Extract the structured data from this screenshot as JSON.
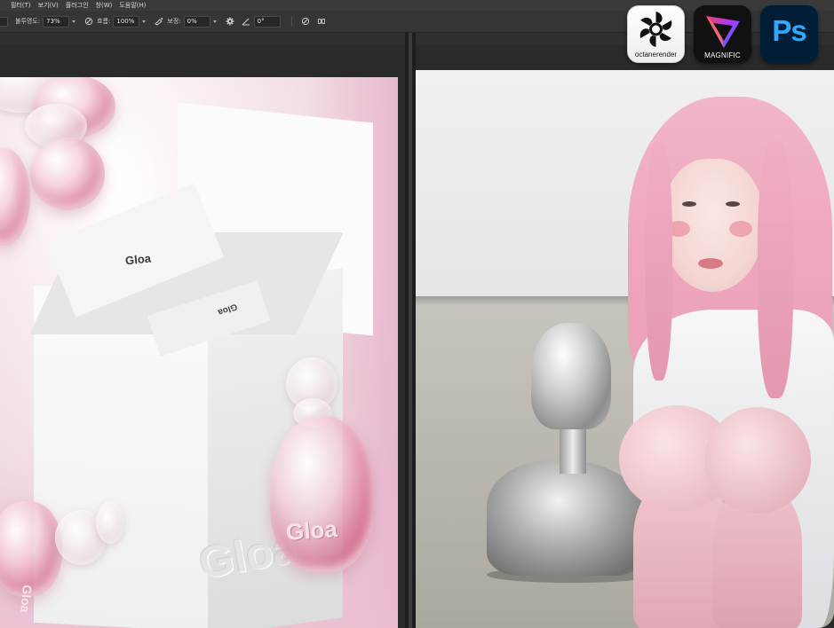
{
  "menubar": {
    "items": [
      "필터(T)",
      "보기(V)",
      "플러그인",
      "창(W)",
      "도움말(H)"
    ]
  },
  "options": {
    "opacity_label": "불투명도:",
    "opacity_value": "73%",
    "flow_label": "흐름:",
    "flow_value": "100%",
    "smoothing_label": "보정:",
    "smoothing_value": "0%",
    "angle_value": "0°"
  },
  "artwork": {
    "brand_name": "Gloa"
  },
  "badges": {
    "octane": {
      "label": "octanerender",
      "icon": "octane-logo-icon"
    },
    "magnific": {
      "label": "MAGNIFIC",
      "icon": "magnific-triangle-icon"
    },
    "photoshop": {
      "label": "Ps",
      "icon": "photoshop-logo-icon"
    }
  },
  "colors": {
    "ps_background": "#001e36",
    "ps_accent": "#31a8ff",
    "magnific_background": "#111111",
    "workspace_background": "#282828"
  }
}
